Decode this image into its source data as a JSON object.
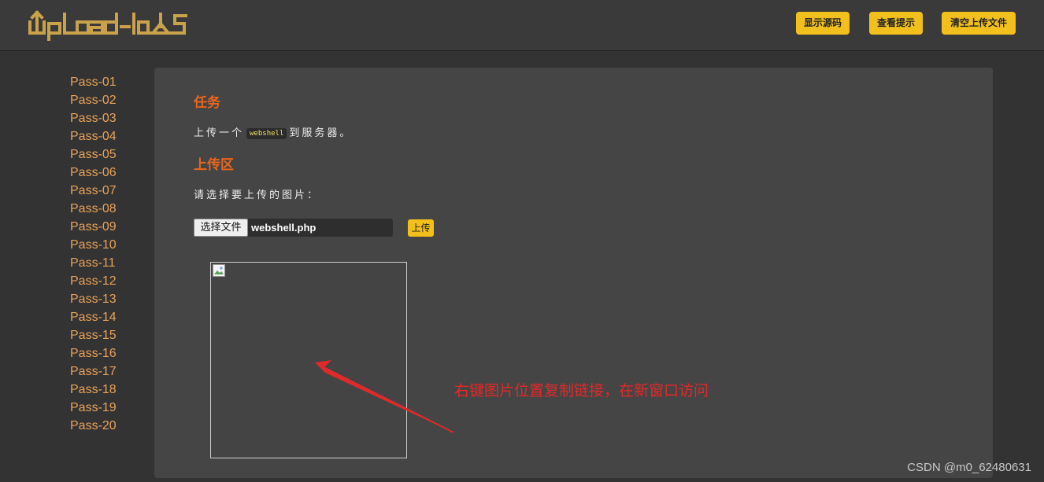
{
  "header": {
    "logo_text": "UpLoad-labs",
    "buttons": {
      "show_source": "显示源码",
      "view_hint": "查看提示",
      "clear_uploads": "清空上传文件"
    }
  },
  "sidebar": {
    "items": [
      "Pass-01",
      "Pass-02",
      "Pass-03",
      "Pass-04",
      "Pass-05",
      "Pass-06",
      "Pass-07",
      "Pass-08",
      "Pass-09",
      "Pass-10",
      "Pass-11",
      "Pass-12",
      "Pass-13",
      "Pass-14",
      "Pass-15",
      "Pass-16",
      "Pass-17",
      "Pass-18",
      "Pass-19",
      "Pass-20"
    ]
  },
  "main": {
    "task_title": "任务",
    "task_text_before": "上传一个",
    "task_code": "webshell",
    "task_text_after": "到服务器。",
    "upload_title": "上传区",
    "upload_prompt": "请选择要上传的图片：",
    "file_button": "选择文件",
    "file_name": "webshell.php",
    "upload_button": "上传"
  },
  "annotation": {
    "text": "右键图片位置复制链接，在新窗口访问",
    "color": "#e02a2a"
  },
  "watermark": "CSDN @m0_62480631",
  "colors": {
    "accent_yellow": "#f2c01c",
    "link_orange": "#e8a25a",
    "heading_orange": "#e8661e"
  }
}
